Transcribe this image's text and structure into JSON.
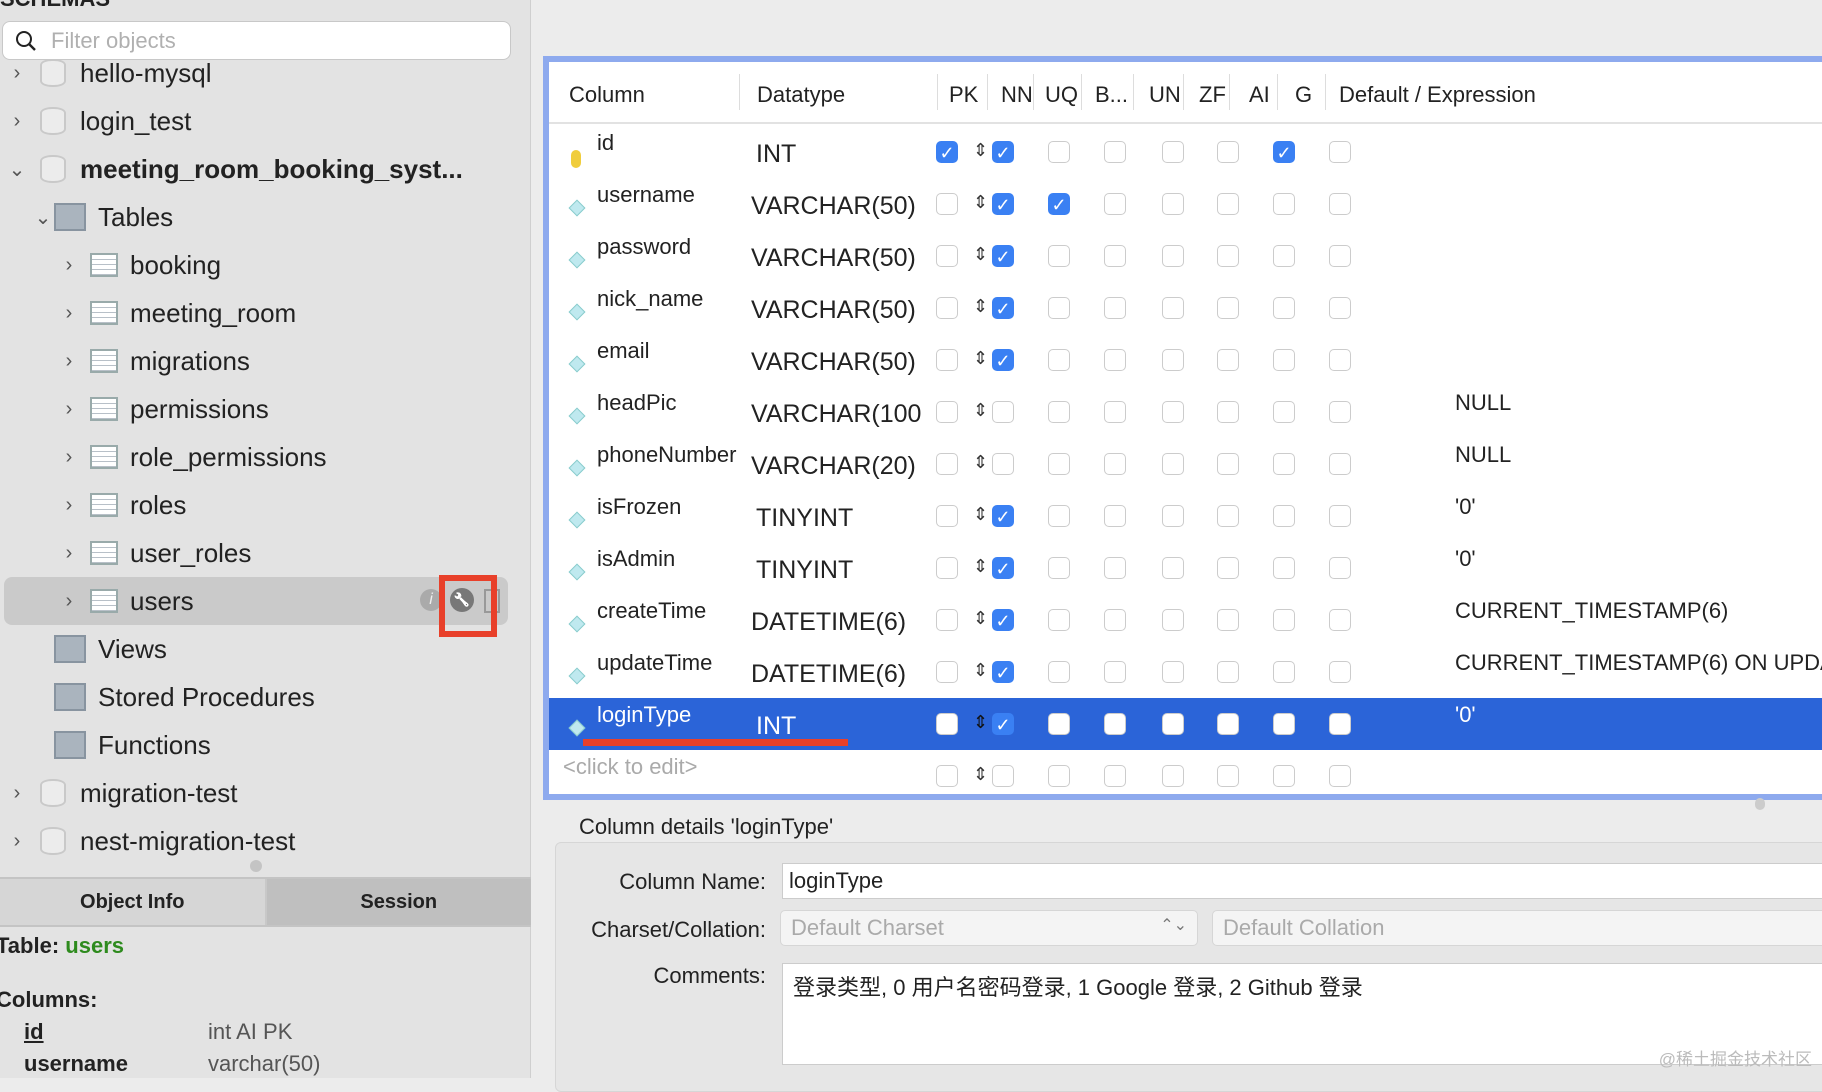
{
  "sidebar": {
    "header": "SCHEMAS",
    "search_placeholder": "Filter objects",
    "tree": [
      {
        "label": "hello-mysql",
        "type": "db",
        "level": 0,
        "chev": "›"
      },
      {
        "label": "login_test",
        "type": "db",
        "level": 0,
        "chev": "›"
      },
      {
        "label": "meeting_room_booking_syst...",
        "type": "db",
        "level": 0,
        "chev": "⌄",
        "bold": true
      },
      {
        "label": "Tables",
        "type": "folder",
        "level": 1,
        "chev": "⌄"
      },
      {
        "label": "booking",
        "type": "table",
        "level": 2,
        "chev": "›"
      },
      {
        "label": "meeting_room",
        "type": "table",
        "level": 2,
        "chev": "›"
      },
      {
        "label": "migrations",
        "type": "table",
        "level": 2,
        "chev": "›"
      },
      {
        "label": "permissions",
        "type": "table",
        "level": 2,
        "chev": "›"
      },
      {
        "label": "role_permissions",
        "type": "table",
        "level": 2,
        "chev": "›"
      },
      {
        "label": "roles",
        "type": "table",
        "level": 2,
        "chev": "›"
      },
      {
        "label": "user_roles",
        "type": "table",
        "level": 2,
        "chev": "›"
      },
      {
        "label": "users",
        "type": "table",
        "level": 2,
        "chev": "›",
        "selected": true
      },
      {
        "label": "Views",
        "type": "folder",
        "level": 1,
        "chev": ""
      },
      {
        "label": "Stored Procedures",
        "type": "folder",
        "level": 1,
        "chev": ""
      },
      {
        "label": "Functions",
        "type": "folder",
        "level": 1,
        "chev": ""
      },
      {
        "label": "migration-test",
        "type": "db",
        "level": 0,
        "chev": "›"
      },
      {
        "label": "nest-migration-test",
        "type": "db",
        "level": 0,
        "chev": "›"
      }
    ],
    "tabs": [
      "Object Info",
      "Session"
    ],
    "info": {
      "table_label": "Table:",
      "table_name": "users",
      "columns_label": "Columns:",
      "columns": [
        {
          "name": "id",
          "type": "int AI PK"
        },
        {
          "name": "username",
          "type": "varchar(50)"
        }
      ]
    },
    "accent": "#2e8b1e"
  },
  "grid": {
    "headers": [
      "Column",
      "Datatype",
      "PK",
      "NN",
      "UQ",
      "B...",
      "UN",
      "ZF",
      "AI",
      "G",
      "Default / Expression"
    ],
    "rows": [
      {
        "name": "id",
        "type": "INT",
        "flags": [
          1,
          1,
          0,
          0,
          0,
          0,
          1,
          0
        ],
        "default": "",
        "key": true
      },
      {
        "name": "username",
        "type": "VARCHAR(50)",
        "flags": [
          0,
          1,
          1,
          0,
          0,
          0,
          0,
          0
        ],
        "default": ""
      },
      {
        "name": "password",
        "type": "VARCHAR(50)",
        "flags": [
          0,
          1,
          0,
          0,
          0,
          0,
          0,
          0
        ],
        "default": ""
      },
      {
        "name": "nick_name",
        "type": "VARCHAR(50)",
        "flags": [
          0,
          1,
          0,
          0,
          0,
          0,
          0,
          0
        ],
        "default": ""
      },
      {
        "name": "email",
        "type": "VARCHAR(50)",
        "flags": [
          0,
          1,
          0,
          0,
          0,
          0,
          0,
          0
        ],
        "default": ""
      },
      {
        "name": "headPic",
        "type": "VARCHAR(100",
        "flags": [
          0,
          0,
          0,
          0,
          0,
          0,
          0,
          0
        ],
        "default": "NULL"
      },
      {
        "name": "phoneNumber",
        "type": "VARCHAR(20)",
        "flags": [
          0,
          0,
          0,
          0,
          0,
          0,
          0,
          0
        ],
        "default": "NULL"
      },
      {
        "name": "isFrozen",
        "type": "TINYINT",
        "flags": [
          0,
          1,
          0,
          0,
          0,
          0,
          0,
          0
        ],
        "default": "'0'"
      },
      {
        "name": "isAdmin",
        "type": "TINYINT",
        "flags": [
          0,
          1,
          0,
          0,
          0,
          0,
          0,
          0
        ],
        "default": "'0'"
      },
      {
        "name": "createTime",
        "type": "DATETIME(6)",
        "flags": [
          0,
          1,
          0,
          0,
          0,
          0,
          0,
          0
        ],
        "default": "CURRENT_TIMESTAMP(6)"
      },
      {
        "name": "updateTime",
        "type": "DATETIME(6)",
        "flags": [
          0,
          1,
          0,
          0,
          0,
          0,
          0,
          0
        ],
        "default": "CURRENT_TIMESTAMP(6) ON UPDA"
      },
      {
        "name": "loginType",
        "type": "INT",
        "flags": [
          0,
          1,
          0,
          0,
          0,
          0,
          0,
          0
        ],
        "default": "'0'",
        "selected": true
      }
    ],
    "new_row_placeholder": "<click to edit>",
    "selection_color": "#2b64d8"
  },
  "details": {
    "title": "Column details 'loginType'",
    "column_name_label": "Column Name:",
    "column_name": "loginType",
    "charset_label": "Charset/Collation:",
    "charset": "Default Charset",
    "collation": "Default Collation",
    "comments_label": "Comments:",
    "comments": "登录类型, 0 用户名密码登录, 1 Google 登录, 2 Github 登录"
  },
  "watermark": "@稀土掘金技术社区"
}
